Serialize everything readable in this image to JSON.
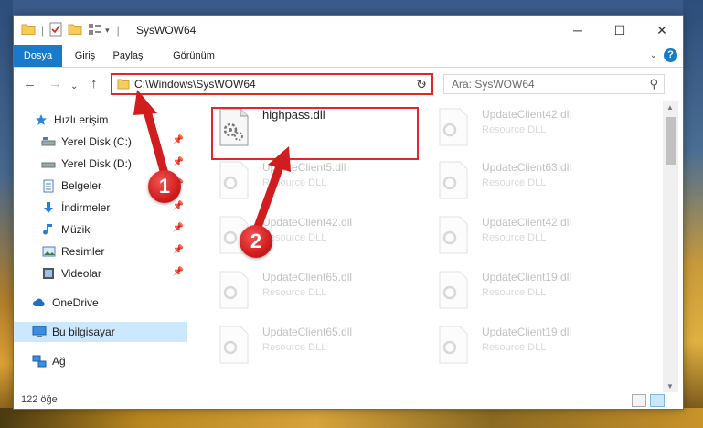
{
  "window": {
    "title": "SysWOW64",
    "controls": {
      "minimize": "─",
      "maximize": "☐",
      "close": "✕"
    }
  },
  "ribbon": {
    "tabs": [
      {
        "label": "Dosya",
        "active": true
      },
      {
        "label": "Giriş",
        "active": false
      },
      {
        "label": "Paylaş",
        "active": false
      },
      {
        "label": "Görünüm",
        "active": false
      }
    ],
    "help": "?"
  },
  "nav": {
    "address": "C:\\Windows\\SysWOW64",
    "search_placeholder": "Ara: SysWOW64"
  },
  "sidebar": {
    "items": [
      {
        "label": "Hızlı erişim",
        "icon": "star-icon",
        "pinned": false
      },
      {
        "label": "Yerel Disk (C:)",
        "icon": "drive-icon",
        "pinned": true
      },
      {
        "label": "Yerel Disk (D:)",
        "icon": "drive-icon",
        "pinned": true
      },
      {
        "label": "Belgeler",
        "icon": "documents-icon",
        "pinned": true
      },
      {
        "label": "İndirmeler",
        "icon": "download-icon",
        "pinned": true
      },
      {
        "label": "Müzik",
        "icon": "music-icon",
        "pinned": true
      },
      {
        "label": "Resimler",
        "icon": "pictures-icon",
        "pinned": true
      },
      {
        "label": "Videolar",
        "icon": "videos-icon",
        "pinned": true
      },
      {
        "label": "OneDrive",
        "icon": "cloud-icon",
        "pinned": false
      },
      {
        "label": "Bu bilgisayar",
        "icon": "computer-icon",
        "pinned": false,
        "selected": true
      },
      {
        "label": "Ağ",
        "icon": "network-icon",
        "pinned": false
      }
    ]
  },
  "files": {
    "highlighted": {
      "name": "highpass.dll"
    },
    "faded": [
      {
        "name": "UpdateClient42.dll",
        "type": "Resource DLL"
      },
      {
        "name": "UpdateClient5.dll",
        "type": "Resource DLL"
      },
      {
        "name": "UpdateClient63.dll",
        "type": "Resource DLL"
      },
      {
        "name": "UpdateClient42.dll",
        "type": "Resource DLL"
      },
      {
        "name": "UpdateClient42.dll",
        "type": "Resource DLL"
      },
      {
        "name": "UpdateClient65.dll",
        "type": "Resource DLL"
      },
      {
        "name": "UpdateClient19.dll",
        "type": "Resource DLL"
      },
      {
        "name": "UpdateClient65.dll",
        "type": "Resource DLL"
      },
      {
        "name": "UpdateClient19.dll",
        "type": "Resource DLL"
      }
    ]
  },
  "status": {
    "count": "122 öğe"
  },
  "callouts": {
    "one": "1",
    "two": "2"
  },
  "colors": {
    "accent": "#1979ca",
    "highlight": "#e0282a",
    "selected": "#cce8ff"
  }
}
